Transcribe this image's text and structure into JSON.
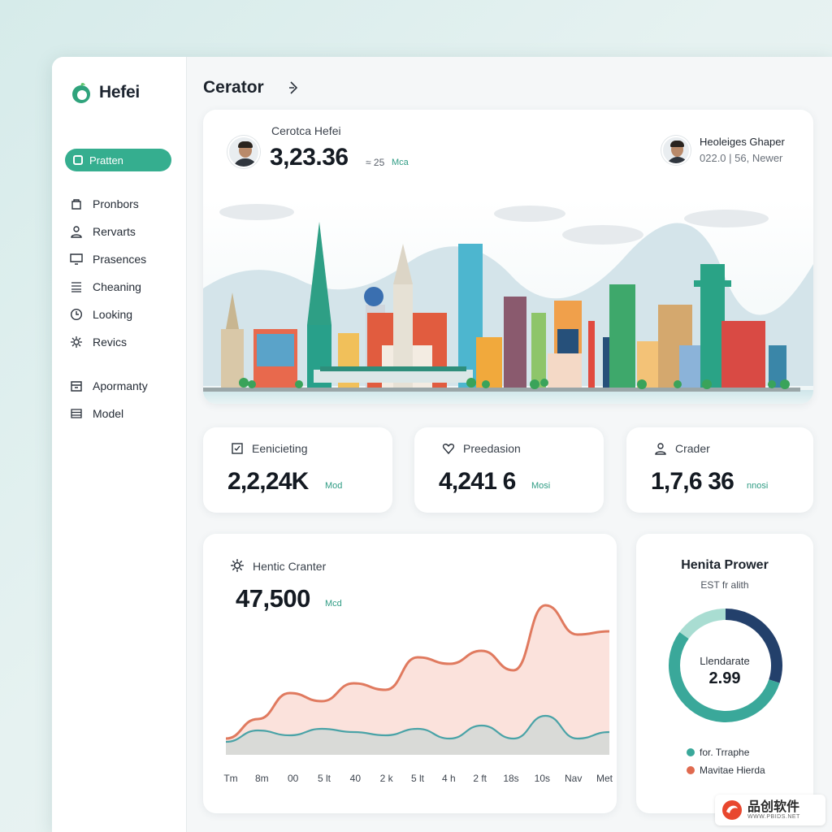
{
  "app": {
    "name": "Hefei"
  },
  "sidebar": {
    "active": {
      "label": "Pratten"
    },
    "items": [
      {
        "label": "Pronbors",
        "icon": "bag-icon"
      },
      {
        "label": "Rervarts",
        "icon": "user-icon"
      },
      {
        "label": "Prasences",
        "icon": "screen-icon"
      },
      {
        "label": "Cheaning",
        "icon": "list-icon"
      },
      {
        "label": "Looking",
        "icon": "clock-icon"
      },
      {
        "label": "Revics",
        "icon": "gear-icon"
      }
    ],
    "items2": [
      {
        "label": "Apormanty",
        "icon": "calendar-icon"
      },
      {
        "label": "Model",
        "icon": "menu-icon"
      }
    ]
  },
  "header": {
    "title": "Cerator"
  },
  "hero": {
    "label": "Cerotca Hefei",
    "value": "3,23.36",
    "sub": "≈ 25",
    "unit": "Mca",
    "name": "Heoleiges Ghaper",
    "meta": "022.0 | 56, Newer"
  },
  "stats": [
    {
      "label": "Eenicieting",
      "value": "2,2,24K",
      "unit": "Mod",
      "icon": "checkbox-icon"
    },
    {
      "label": "Preedasion",
      "value": "4,241 6",
      "unit": "Mosi",
      "icon": "heart-icon"
    },
    {
      "label": "Crader",
      "value": "1,7,6 36",
      "unit": "nnosi",
      "icon": "user-icon"
    }
  ],
  "trend": {
    "label": "Hentic Cranter",
    "value": "47,500",
    "unit": "Mcd",
    "icon": "gear-icon"
  },
  "chart_data": {
    "type": "area",
    "categories": [
      "Tm",
      "8m",
      "00",
      "5 lt",
      "40",
      "2 k",
      "5 lt",
      "4 h",
      "2 ft",
      "18s",
      "10s",
      "Nav",
      "Met"
    ],
    "series": [
      {
        "color": "#e07a5f",
        "values": [
          10,
          22,
          38,
          33,
          44,
          40,
          60,
          56,
          64,
          52,
          92,
          74,
          76
        ]
      },
      {
        "color": "#4aa3a7",
        "values": [
          8,
          15,
          12,
          16,
          14,
          12,
          16,
          10,
          18,
          10,
          24,
          10,
          14
        ]
      }
    ],
    "ylim": [
      0,
      100
    ],
    "grid": false
  },
  "donut": {
    "title": "Henita Prower",
    "sub": "EST fr alith",
    "center_label": "Llendarate",
    "center_value": "2.99",
    "segments": [
      {
        "value": 30,
        "color": "#23406b"
      },
      {
        "value": 55,
        "color": "#3aa89a"
      },
      {
        "value": 15,
        "color": "#a9ddd2"
      }
    ],
    "legend": [
      {
        "label": "for. Trraphe",
        "color": "#3aa89a"
      },
      {
        "label": "Mavitae Hierda",
        "color": "#e06a4f"
      }
    ]
  },
  "watermark": {
    "text": "品创软件",
    "sub": "WWW.PBIDS.NET"
  }
}
